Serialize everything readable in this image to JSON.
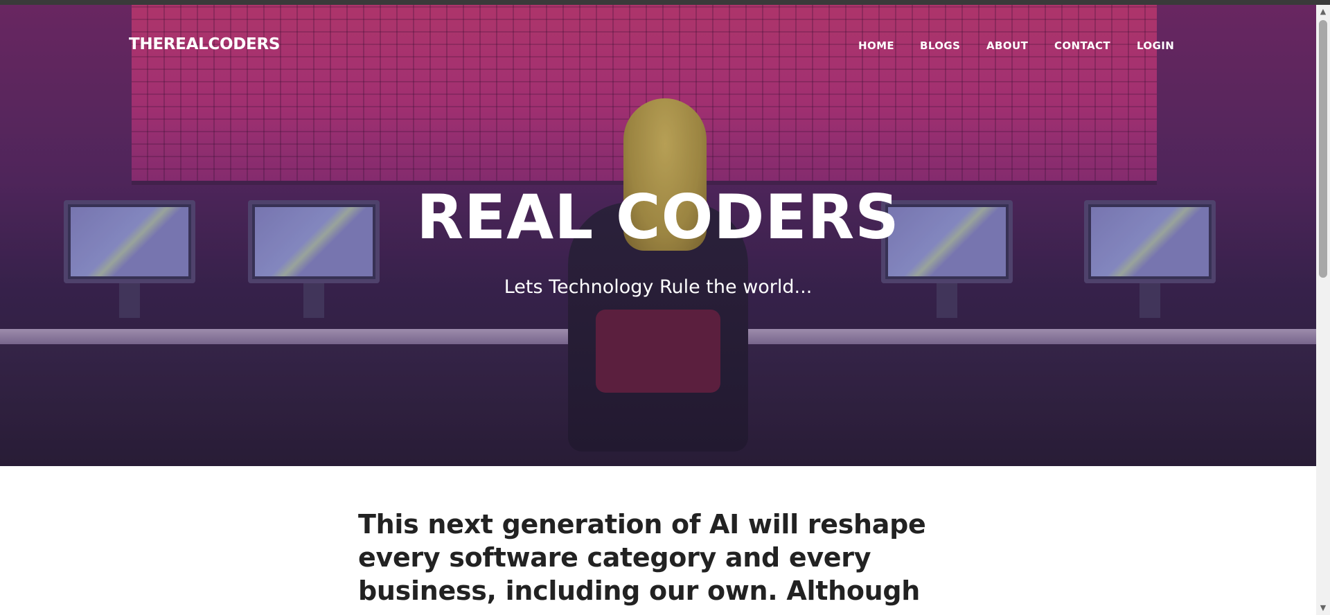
{
  "header": {
    "brand": "THEREALCODERS",
    "nav": [
      {
        "label": "HOME"
      },
      {
        "label": "BLOGS"
      },
      {
        "label": "ABOUT"
      },
      {
        "label": "CONTACT"
      },
      {
        "label": "LOGIN"
      }
    ]
  },
  "hero": {
    "title": "REAL CODERS",
    "subtitle": "Lets Technology Rule the world..."
  },
  "article": {
    "lines": [
      "This next generation of AI will reshape",
      "every software category and every",
      "business, including our own. Although"
    ]
  },
  "scrollbar": {
    "up_arrow": "▲",
    "down_arrow": "▼"
  },
  "colors": {
    "hero_overlay": "#5a2b66",
    "wall_accent": "#d6407c",
    "text_dark": "#222222",
    "text_light": "#ffffff"
  }
}
